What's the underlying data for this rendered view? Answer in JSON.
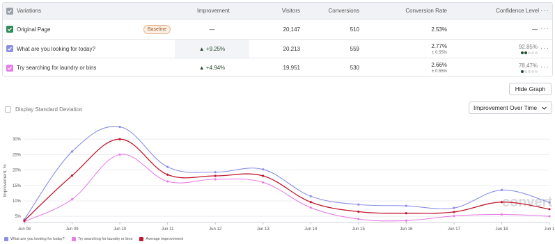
{
  "table": {
    "headers": {
      "variations": "Variations",
      "improvement": "Improvement",
      "visitors": "Visitors",
      "conversions": "Conversions",
      "conversion_rate": "Conversion Rate",
      "confidence_level": "Confidence Level"
    },
    "more_icon": "···",
    "rows": [
      {
        "name": "Original Page",
        "badge": "Baseline",
        "improvement": "—",
        "visitors": "20,147",
        "conversions": "510",
        "conversion_rate": "2.53%",
        "conversion_rate_sub": "",
        "confidence": "—",
        "color": "#2e8b57"
      },
      {
        "name": "What are you looking for today?",
        "improvement": "▲ +9.25%",
        "visitors": "20,213",
        "conversions": "559",
        "conversion_rate": "2.77%",
        "conversion_rate_sub": "± 0.55%",
        "confidence": "92.85%",
        "confidence_dots": 2,
        "color": "#8a8fe6"
      },
      {
        "name": "Try searching for laundry or bins",
        "improvement": "▲ +4.94%",
        "visitors": "19,951",
        "conversions": "530",
        "conversion_rate": "2.66%",
        "conversion_rate_sub": "± 0.55%",
        "confidence": "78.47%",
        "confidence_dots": 1,
        "color": "#e77ee6"
      }
    ]
  },
  "controls": {
    "hide_graph": "Hide Graph",
    "display_std": "Display Standard Deviation",
    "graph_mode": "Improvement Over Time"
  },
  "chart_data": {
    "type": "line",
    "ylabel": "Improvement, %",
    "y_ticks": [
      "5%",
      "10%",
      "15%",
      "20%",
      "25%",
      "30%"
    ],
    "ylim": [
      3,
      35
    ],
    "x": [
      "Jun 08",
      "Jun 09",
      "Jun 10",
      "Jun 11",
      "Jun 12",
      "Jun 13",
      "Jun 14",
      "Jun 15",
      "Jun 16",
      "Jun 17",
      "Jun 18",
      "Jun 1"
    ],
    "series": [
      {
        "name": "What are you looking for today?",
        "color": "#8a8fe6",
        "values": [
          4,
          26,
          34,
          21,
          19.3,
          20.2,
          11.5,
          8.8,
          8.4,
          7.7,
          13.5,
          9.5
        ]
      },
      {
        "name": "Try searching for laundry or bins",
        "color": "#e77ee6",
        "values": [
          3.3,
          10.5,
          25,
          16.3,
          17,
          16,
          7.8,
          4.1,
          3.6,
          5.1,
          5.6,
          5
        ]
      },
      {
        "name": "Average improvement",
        "color": "#c0182e",
        "values": [
          3.6,
          18.2,
          30,
          18.5,
          18.1,
          18.1,
          9.6,
          6.5,
          6,
          6.4,
          9.6,
          7.3
        ]
      }
    ],
    "watermark": "convert"
  }
}
